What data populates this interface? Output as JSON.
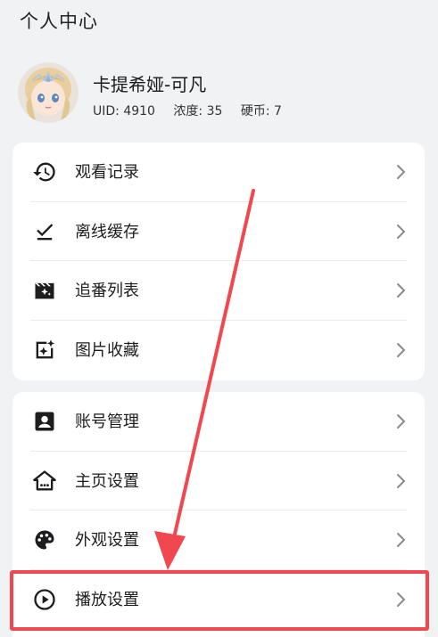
{
  "header": {
    "title": "个人中心"
  },
  "profile": {
    "name": "卡提希娅-可凡",
    "uid": "UID: 4910",
    "level": "浓度: 35",
    "coins": "硬币: 7"
  },
  "group1": [
    {
      "label": "观看记录",
      "icon": "history-icon"
    },
    {
      "label": "离线缓存",
      "icon": "download-check-icon"
    },
    {
      "label": "追番列表",
      "icon": "movie-sparkle-icon"
    },
    {
      "label": "图片收藏",
      "icon": "image-sparkle-icon"
    }
  ],
  "group2": [
    {
      "label": "账号管理",
      "icon": "account-box-icon"
    },
    {
      "label": "主页设置",
      "icon": "home-settings-icon"
    },
    {
      "label": "外观设置",
      "icon": "palette-icon"
    },
    {
      "label": "播放设置",
      "icon": "play-circle-icon"
    }
  ],
  "colors": {
    "highlight": "#f0484e",
    "background": "#f1f2f4",
    "card": "#ffffff"
  }
}
